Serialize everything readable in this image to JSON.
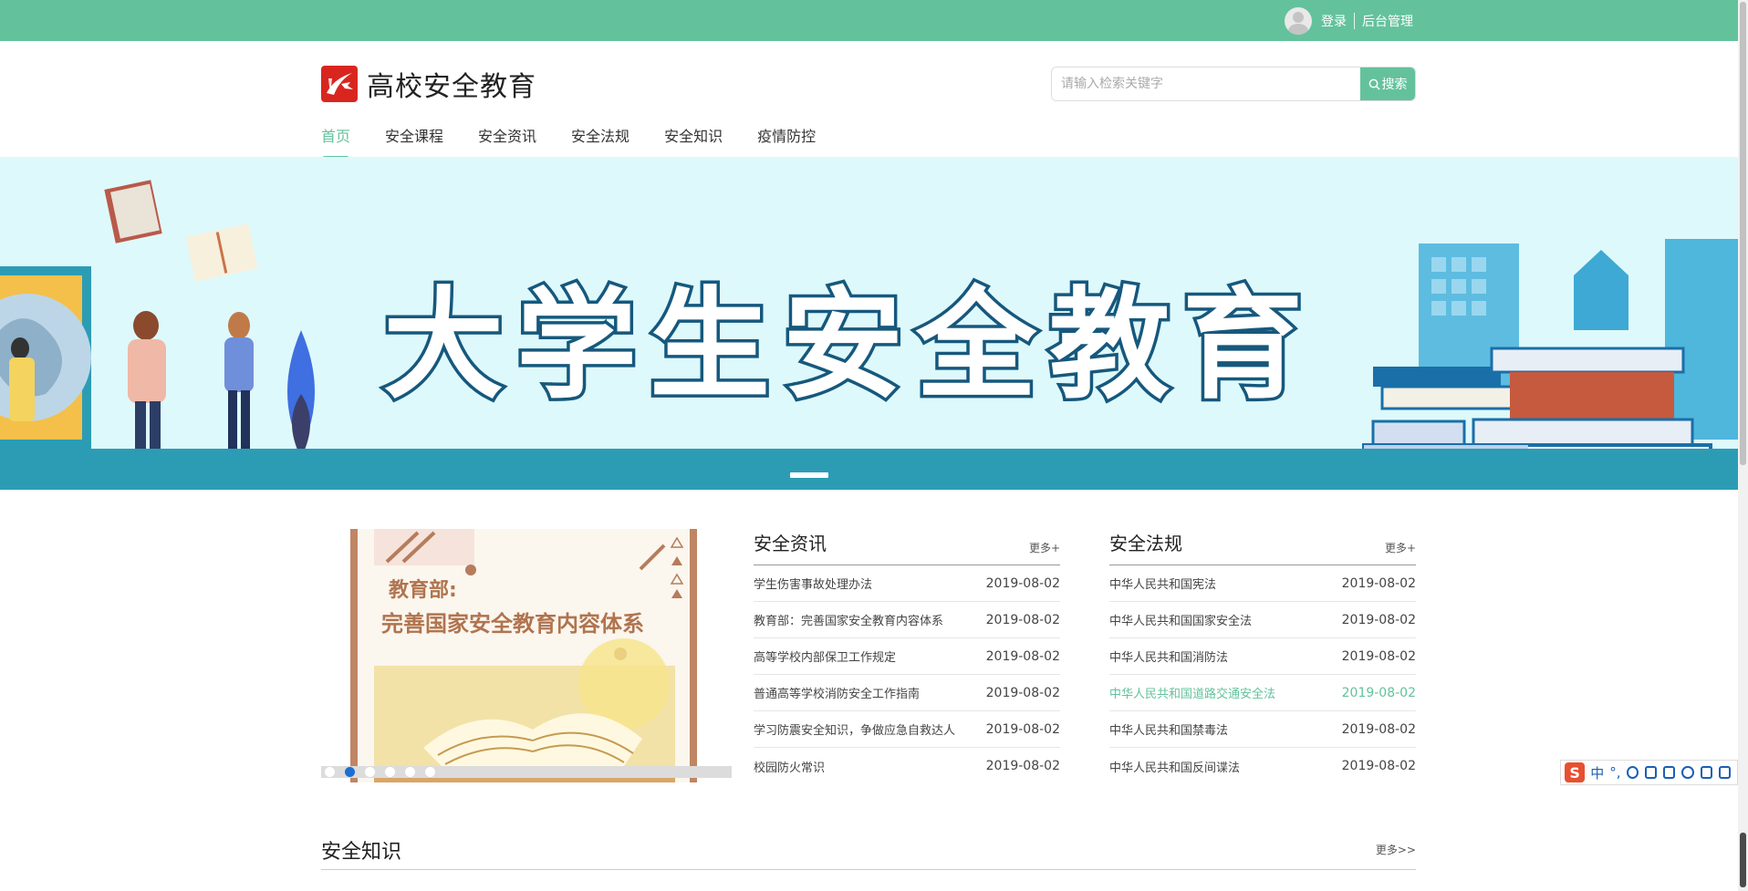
{
  "topbar": {
    "login": "登录",
    "admin": "后台管理"
  },
  "header": {
    "logo_text": "高校安全教育",
    "search_placeholder": "请输入检索关键字",
    "search_button": "搜索"
  },
  "nav": [
    "首页",
    "安全课程",
    "安全资讯",
    "安全法规",
    "安全知识",
    "疫情防控"
  ],
  "banner": {
    "title": "大学生安全教育"
  },
  "feature": {
    "line1": "教育部:",
    "line2": "完善国家安全教育内容体系"
  },
  "news": {
    "title": "安全资讯",
    "more": "更多+",
    "items": [
      {
        "title": "学生伤害事故处理办法",
        "date": "2019-08-02"
      },
      {
        "title": "教育部：完善国家安全教育内容体系",
        "date": "2019-08-02"
      },
      {
        "title": "高等学校内部保卫工作规定",
        "date": "2019-08-02"
      },
      {
        "title": "普通高等学校消防安全工作指南",
        "date": "2019-08-02"
      },
      {
        "title": "学习防震安全知识，争做应急自救达人",
        "date": "2019-08-02"
      },
      {
        "title": "校园防火常识",
        "date": "2019-08-02"
      }
    ]
  },
  "laws": {
    "title": "安全法规",
    "more": "更多+",
    "items": [
      {
        "title": "中华人民共和国宪法",
        "date": "2019-08-02"
      },
      {
        "title": "中华人民共和国国家安全法",
        "date": "2019-08-02"
      },
      {
        "title": "中华人民共和国消防法",
        "date": "2019-08-02"
      },
      {
        "title": "中华人民共和国道路交通安全法",
        "date": "2019-08-02"
      },
      {
        "title": "中华人民共和国禁毒法",
        "date": "2019-08-02"
      },
      {
        "title": "中华人民共和国反间谍法",
        "date": "2019-08-02"
      }
    ]
  },
  "knowledge": {
    "title": "安全知识",
    "more": "更多>>"
  },
  "ime": {
    "lang": "中",
    "punct": "°,"
  },
  "colors": {
    "accent": "#63c29c",
    "banner_bg": "#def9fb",
    "banner_strip": "#2c9cb5",
    "title_stroke": "#16587d"
  }
}
